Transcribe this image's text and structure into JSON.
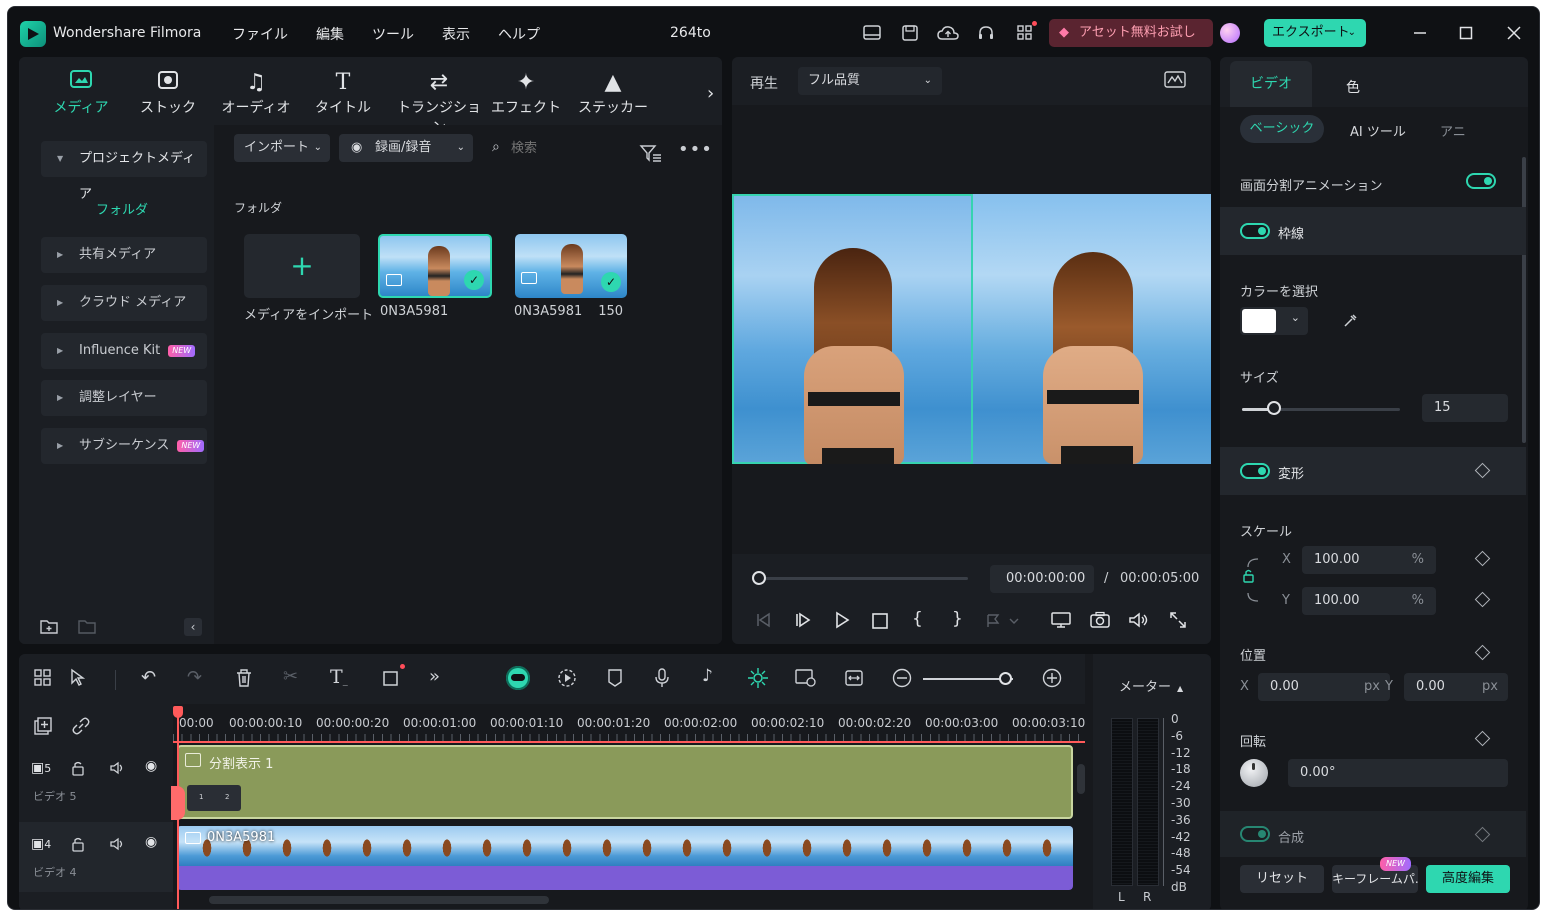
{
  "app": {
    "title": "Wondershare Filmora",
    "project": "264to"
  },
  "menu": [
    "ファイル",
    "編集",
    "ツール",
    "表示",
    "ヘルプ"
  ],
  "header": {
    "promo": "アセット無料お試し",
    "export": "エクスポート"
  },
  "media_tabs": [
    {
      "icon": "media-icon",
      "label": "メディア"
    },
    {
      "icon": "stock-icon",
      "label": "ストック"
    },
    {
      "icon": "music-icon",
      "label": "オーディオ"
    },
    {
      "icon": "title-icon",
      "label": "タイトル"
    },
    {
      "icon": "transition-icon",
      "label": "トランジション"
    },
    {
      "icon": "effect-icon",
      "label": "エフェクト"
    },
    {
      "icon": "sticker-icon",
      "label": "ステッカー"
    }
  ],
  "sidebar": {
    "project_media": "プロジェクトメディア",
    "folder": "フォルダ",
    "items": [
      {
        "label": "共有メディア",
        "badge": ""
      },
      {
        "label": "クラウド メディア",
        "badge": ""
      },
      {
        "label": "Influence Kit",
        "badge": "NEW"
      },
      {
        "label": "調整レイヤー",
        "badge": ""
      },
      {
        "label": "サブシーケンス",
        "badge": "NEW"
      }
    ]
  },
  "library": {
    "import": "インポート",
    "record": "録画/録音",
    "search_placeholder": "検索",
    "folder_title": "フォルダ",
    "import_media": "メディアをインポート",
    "clips": [
      {
        "name": "0N3A5981"
      },
      {
        "name": "0N3A5981",
        "extra": "150"
      }
    ]
  },
  "preview": {
    "play_label": "再生",
    "quality": "フル品質",
    "current": "00:00:00:00",
    "separator": "/",
    "total": "00:00:05:00"
  },
  "inspector": {
    "tabs": [
      "ビデオ",
      "色"
    ],
    "subtabs": [
      "ベーシック",
      "AI ツール",
      "アニ"
    ],
    "split_anim": "画面分割アニメーション",
    "border": "枠線",
    "color_label": "カラーを選択",
    "size_label": "サイズ",
    "size_value": "15",
    "transform": "変形",
    "scale_label": "スケール",
    "scale_x": "100.00",
    "scale_y": "100.00",
    "percent": "%",
    "x_label": "X",
    "y_label": "Y",
    "position_label": "位置",
    "pos_x": "0.00",
    "pos_y": "0.00",
    "px": "px",
    "rotation_label": "回転",
    "rotation": "0.00°",
    "composite": "合成",
    "reset": "リセット",
    "keyframe": "キーフレームパ...",
    "keyframe_badge": "NEW",
    "advanced": "高度編集",
    "size_fraction": 0.2
  },
  "timeline": {
    "ruler": [
      "00:00",
      "00:00:00:10",
      "00:00:00:20",
      "00:00:01:00",
      "00:00:01:10",
      "00:00:01:20",
      "00:00:02:00",
      "00:00:02:10",
      "00:00:02:20",
      "00:00:03:00",
      "00:00:03:10"
    ],
    "track5": {
      "num": "5",
      "name": "ビデオ 5",
      "clip": "分割表示 1",
      "mini": [
        "1",
        "2"
      ]
    },
    "track4": {
      "num": "4",
      "name": "ビデオ 4",
      "clip": "0N3A5981"
    },
    "meter_label": "メーター",
    "meter_scale": [
      "0",
      "-6",
      "-12",
      "-18",
      "-24",
      "-30",
      "-36",
      "-42",
      "-48",
      "-54",
      "dB"
    ],
    "meter_lr": [
      "L",
      "R"
    ]
  }
}
